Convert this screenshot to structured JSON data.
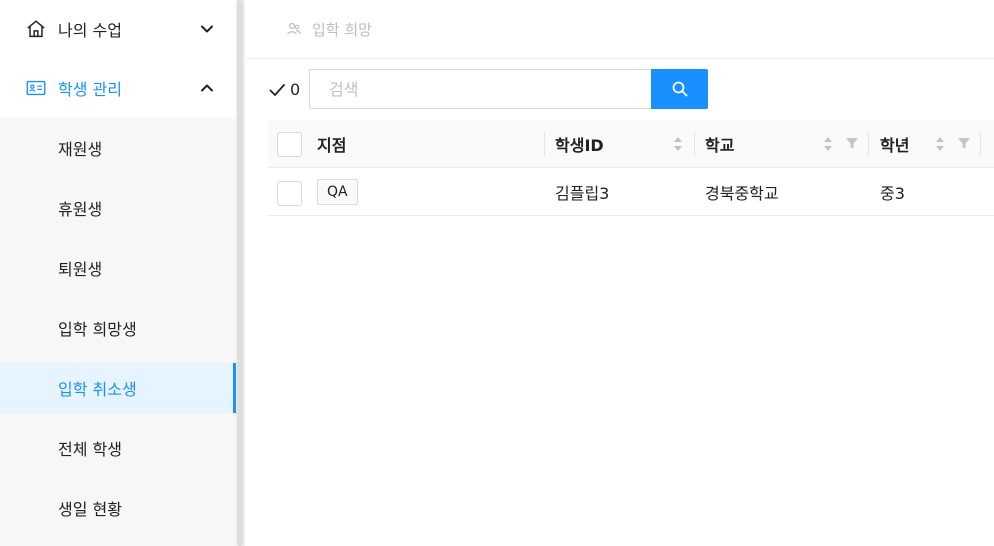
{
  "sidebar": {
    "menus": [
      {
        "label": "나의 수업",
        "icon": "home-icon",
        "expanded": false,
        "active": false
      },
      {
        "label": "학생 관리",
        "icon": "id-card-icon",
        "expanded": true,
        "active": true
      }
    ],
    "submenu": [
      {
        "label": "재원생",
        "selected": false
      },
      {
        "label": "휴원생",
        "selected": false
      },
      {
        "label": "퇴원생",
        "selected": false
      },
      {
        "label": "입학 희망생",
        "selected": false
      },
      {
        "label": "입학 취소생",
        "selected": true
      },
      {
        "label": "전체 학생",
        "selected": false
      },
      {
        "label": "생일 현황",
        "selected": false
      }
    ]
  },
  "topbar": {
    "tab_label": "입학 희망",
    "tab_icon": "user-group-icon"
  },
  "toolbar": {
    "checked_count": "0",
    "search_placeholder": "검색",
    "search_icon": "search-icon"
  },
  "table": {
    "columns": [
      {
        "label": "지점",
        "sortable": false,
        "filterable": false
      },
      {
        "label": "학생ID",
        "sortable": true,
        "filterable": false
      },
      {
        "label": "학교",
        "sortable": true,
        "filterable": true
      },
      {
        "label": "학년",
        "sortable": true,
        "filterable": true
      }
    ],
    "rows": [
      {
        "branch": "QA",
        "student_id": "김플립3",
        "school": "경북중학교",
        "grade": "중3"
      }
    ]
  },
  "colors": {
    "accent": "#1890ff",
    "selected_bg": "#e6f4ff",
    "submenu_bg": "#f7f7f7"
  }
}
